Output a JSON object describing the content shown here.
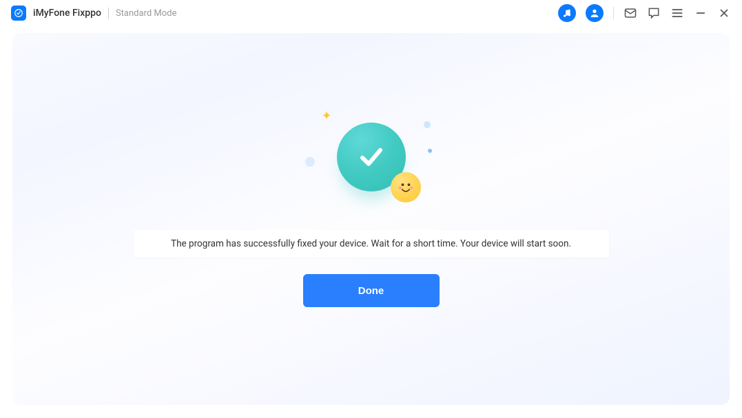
{
  "header": {
    "app_name": "iMyFone Fixppo",
    "mode": "Standard Mode"
  },
  "main": {
    "message": "The program has successfully fixed your device. Wait for a short time. Your device will start soon.",
    "done_label": "Done"
  }
}
